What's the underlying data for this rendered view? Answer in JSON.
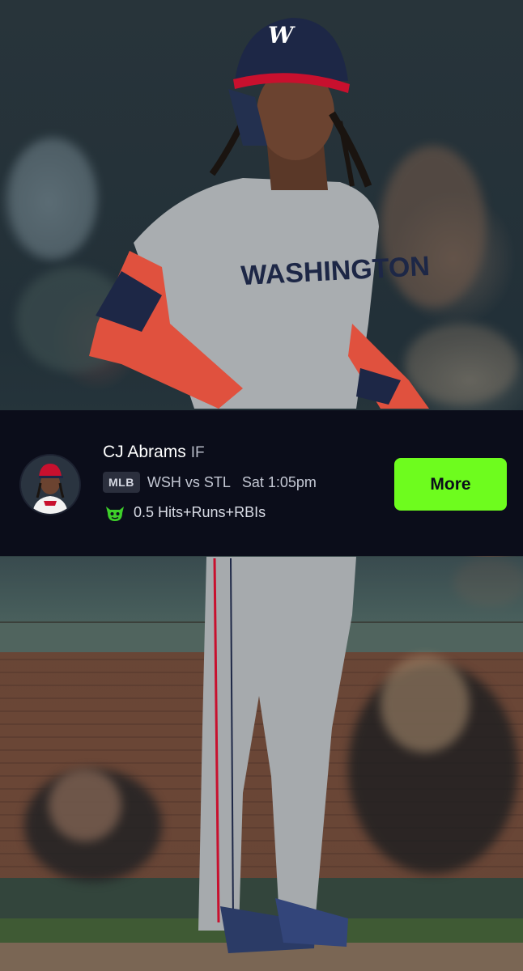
{
  "player_card": {
    "name": "CJ Abrams",
    "position": "IF",
    "league": "MLB",
    "matchup": "WSH vs STL",
    "game_time": "Sat 1:05pm",
    "prop_line": "0.5 Hits+Runs+RBIs",
    "prop_icon": "goblin-icon",
    "more_label": "More"
  },
  "colors": {
    "card_background": "#0b0d1a",
    "more_button": "#6efc1e",
    "jersey_gray": "#a9adb0",
    "team_red": "#c8102e",
    "helmet_navy": "#1d2746"
  }
}
